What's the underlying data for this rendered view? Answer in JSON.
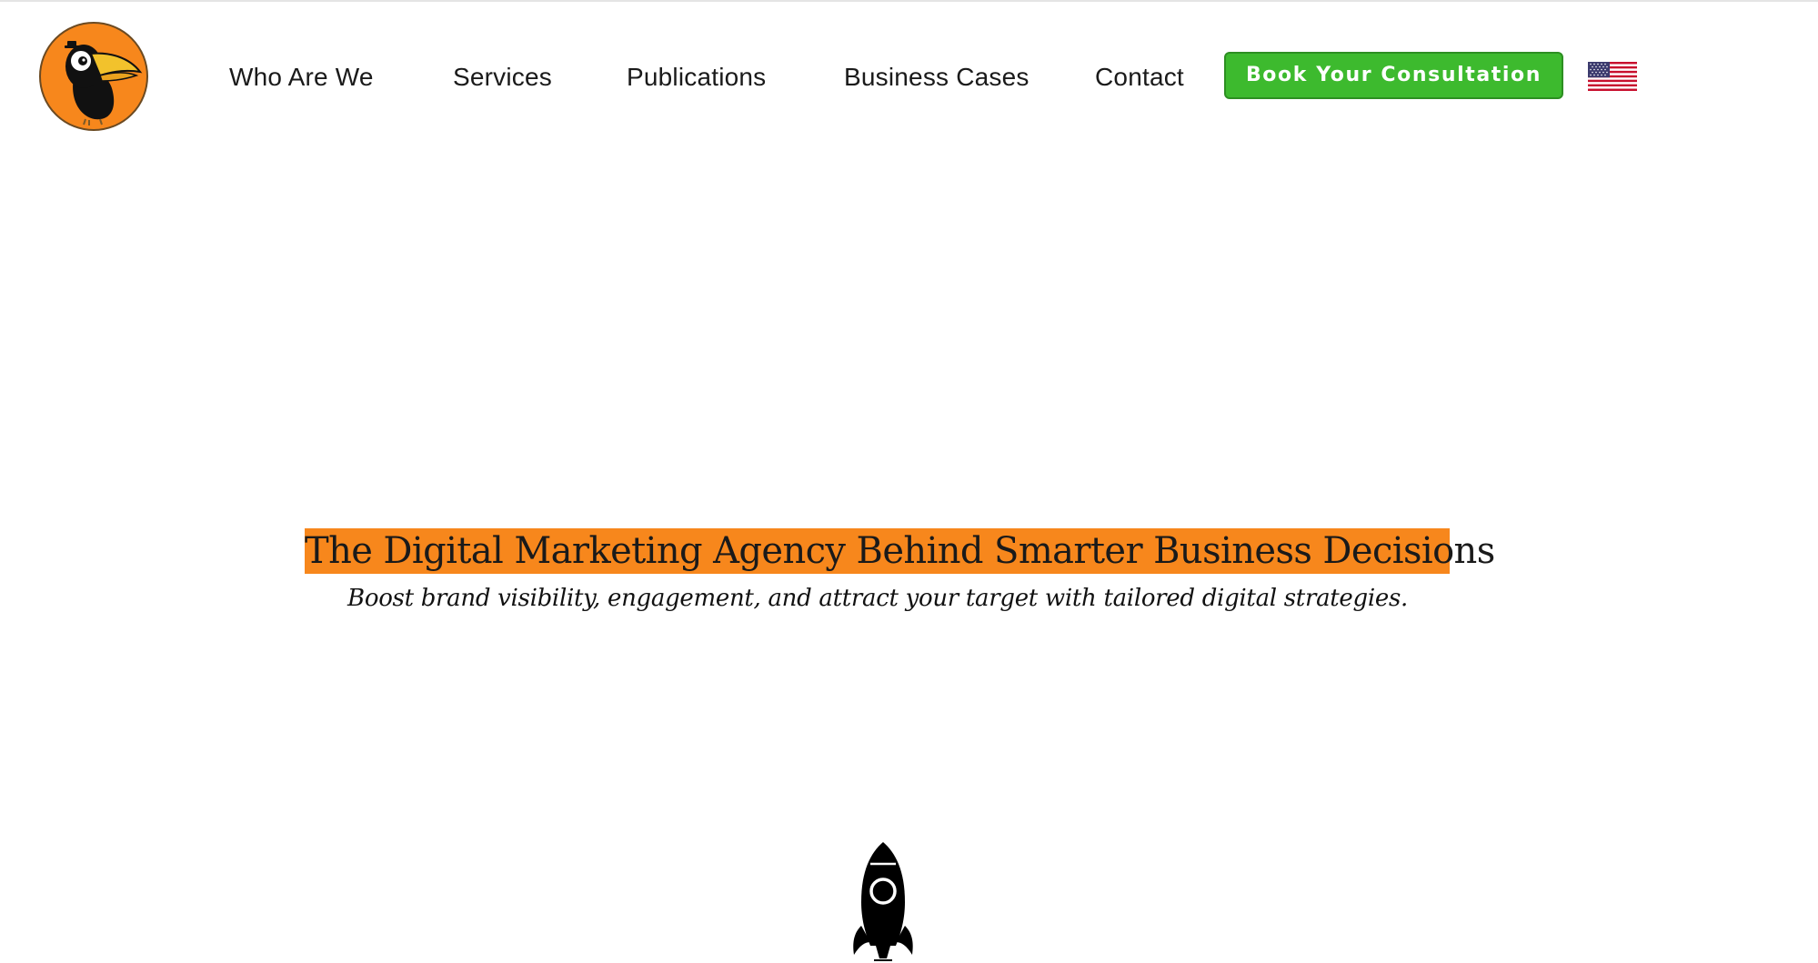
{
  "header": {
    "logo_name": "toucan-logo",
    "nav": [
      {
        "label": "Who Are We"
      },
      {
        "label": "Services"
      },
      {
        "label": "Publications"
      },
      {
        "label": "Business Cases"
      },
      {
        "label": "Contact"
      }
    ],
    "cta_label": "Book Your Consultation",
    "language_icon": "us-flag-icon"
  },
  "hero": {
    "title": "The Digital Marketing Agency Behind Smarter Business Decisions",
    "subtitle": "Boost brand visibility, engagement, and attract your target with tailored digital strategies.",
    "icon": "rocket-icon"
  },
  "colors": {
    "accent_orange": "#f7871c",
    "cta_green": "#3dba2e",
    "text": "#1a1a1a"
  }
}
